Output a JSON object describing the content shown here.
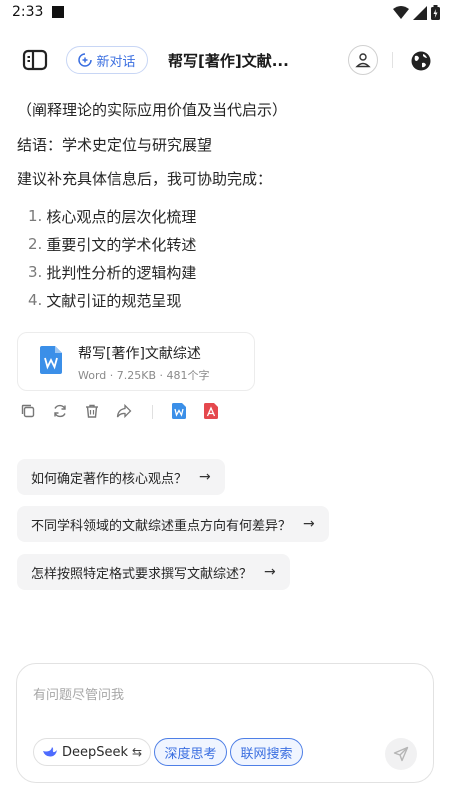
{
  "status_bar": {
    "time": "2:33"
  },
  "header": {
    "new_chat_label": "新对话",
    "title": "帮写[著作]文献..."
  },
  "content": {
    "lines": [
      "（阐释理论的实际应用价值及当代启示）",
      "结语：学术史定位与研究展望",
      "建议补充具体信息后，我可协助完成："
    ],
    "list": [
      {
        "num": "1.",
        "text": "核心观点的层次化梳理"
      },
      {
        "num": "2.",
        "text": "重要引文的学术化转述"
      },
      {
        "num": "3.",
        "text": "批判性分析的逻辑构建"
      },
      {
        "num": "4.",
        "text": "文献引证的规范呈现"
      }
    ]
  },
  "file": {
    "name": "帮写[著作]文献综述",
    "meta": "Word · 7.25KB · 481个字"
  },
  "suggestions": [
    "如何确定著作的核心观点？",
    "不同学科领域的文献综述重点方向有何差异？",
    "怎样按照特定格式要求撰写文献综述？"
  ],
  "composer": {
    "placeholder": "有问题尽管问我",
    "model_label": "DeepSeek",
    "model_switch_glyph": "⇆",
    "deep_think_label": "深度思考",
    "web_search_label": "联网搜索"
  },
  "colors": {
    "accent": "#3b6fe0",
    "word_blue": "#3b8fe8",
    "pdf_red": "#e5484d"
  }
}
